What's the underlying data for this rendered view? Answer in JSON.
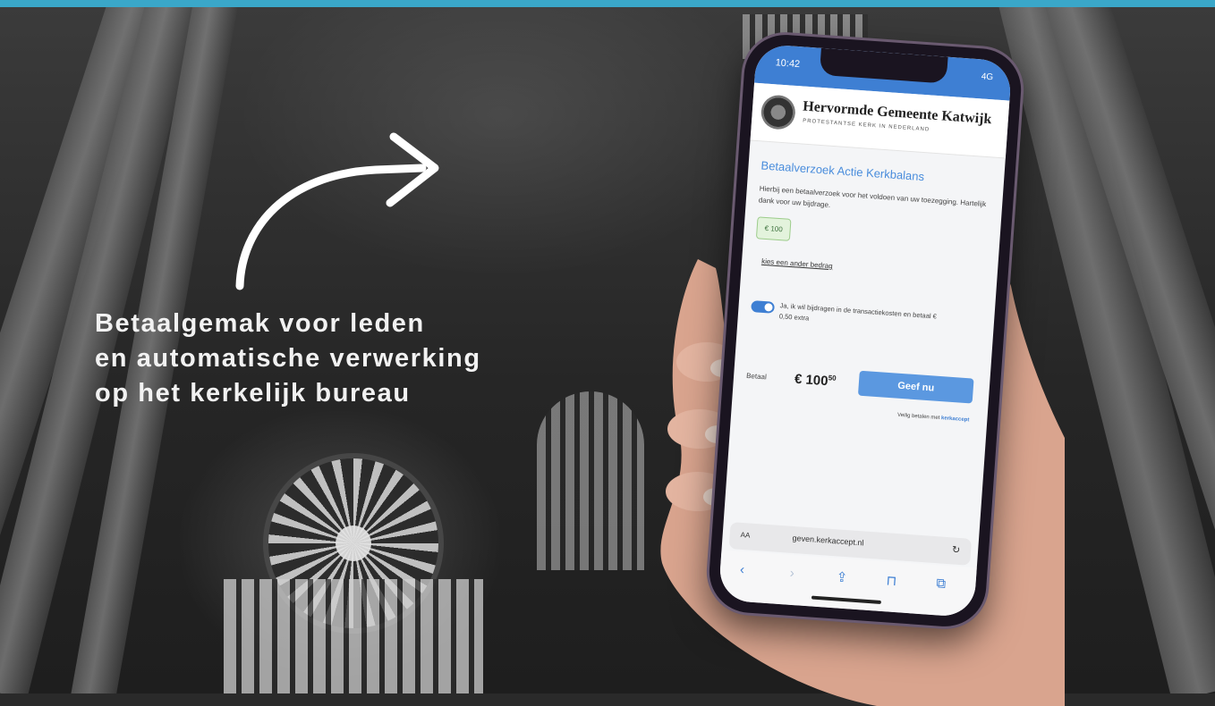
{
  "headline": {
    "line1": "Betaalgemak voor leden",
    "line2": "en automatische verwerking",
    "line3": "op het kerkelijk bureau"
  },
  "phone": {
    "status_time": "10:42",
    "status_icons": "4G",
    "site_title": "Hervormde Gemeente Katwijk",
    "site_subtitle": "PROTESTANTSE KERK IN NEDERLAND",
    "request_title": "Betaalverzoek Actie Kerkbalans",
    "request_body": "Hierbij een betaalverzoek voor het voldoen van uw toezegging. Hartelijk dank voor uw bijdrage.",
    "amount_option": "€ 100",
    "other_amount_link": "kies een ander bedrag",
    "toggle_text": "Ja, ik wil bijdragen in de transactiekosten en betaal € 0,50 extra",
    "pay_label": "Betaal",
    "pay_amount": "€ 100",
    "pay_amount_cents": "50",
    "give_button": "Geef nu",
    "powered_prefix": "Veilig betalen met",
    "powered_brand": "kerkaccept",
    "url_aa": "AA",
    "url_text": "geven.kerkaccept.nl",
    "url_reload": "↻",
    "toolbar_back": "‹",
    "toolbar_forward": "›",
    "toolbar_share": "⇪",
    "toolbar_bookmarks": "⊓",
    "toolbar_tabs": "⧉"
  },
  "colors": {
    "accent_bar": "#3aa7c9",
    "brand_blue": "#3e7fd3"
  }
}
